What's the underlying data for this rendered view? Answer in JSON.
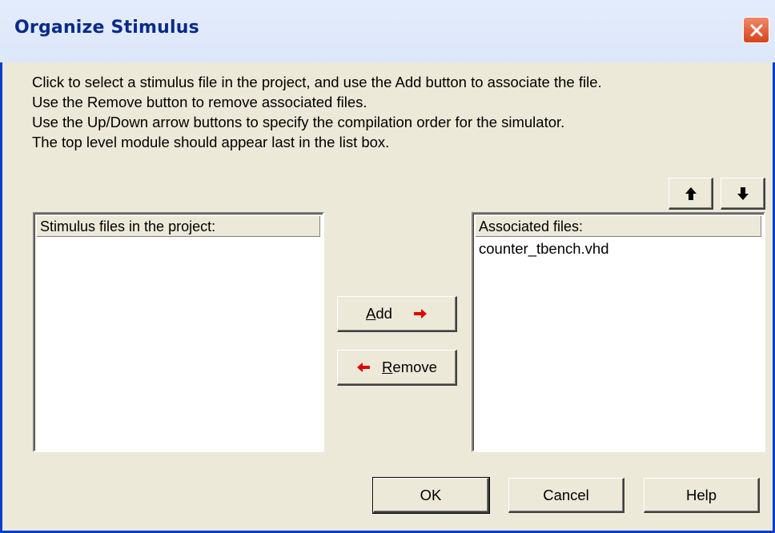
{
  "window": {
    "title": "Organize Stimulus"
  },
  "instructions": [
    "Click to select a stimulus file in the project, and use the Add button to associate the file.",
    "Use the Remove button to remove associated files.",
    "Use the Up/Down arrow buttons to specify the compilation order for the simulator.",
    "The top level module should appear last in the list box."
  ],
  "left_list": {
    "header": "Stimulus files in the project:",
    "items": []
  },
  "right_list": {
    "header": "Associated files:",
    "items": [
      "counter_tbench.vhd"
    ]
  },
  "buttons": {
    "add": {
      "mnemonic": "A",
      "rest": "dd"
    },
    "remove": {
      "mnemonic": "R",
      "rest": "emove"
    },
    "ok": "OK",
    "cancel": "Cancel",
    "help": "Help"
  },
  "icons": {
    "close": "close-icon",
    "up": "arrow-up-icon",
    "down": "arrow-down-icon",
    "add_arrow": "arrow-right-icon",
    "remove_arrow": "arrow-left-icon"
  },
  "colors": {
    "title_text": "#0a2a8a",
    "close_button": "#d5431a",
    "arrow_red": "#e00000",
    "dialog_bg": "#ece9d8"
  }
}
